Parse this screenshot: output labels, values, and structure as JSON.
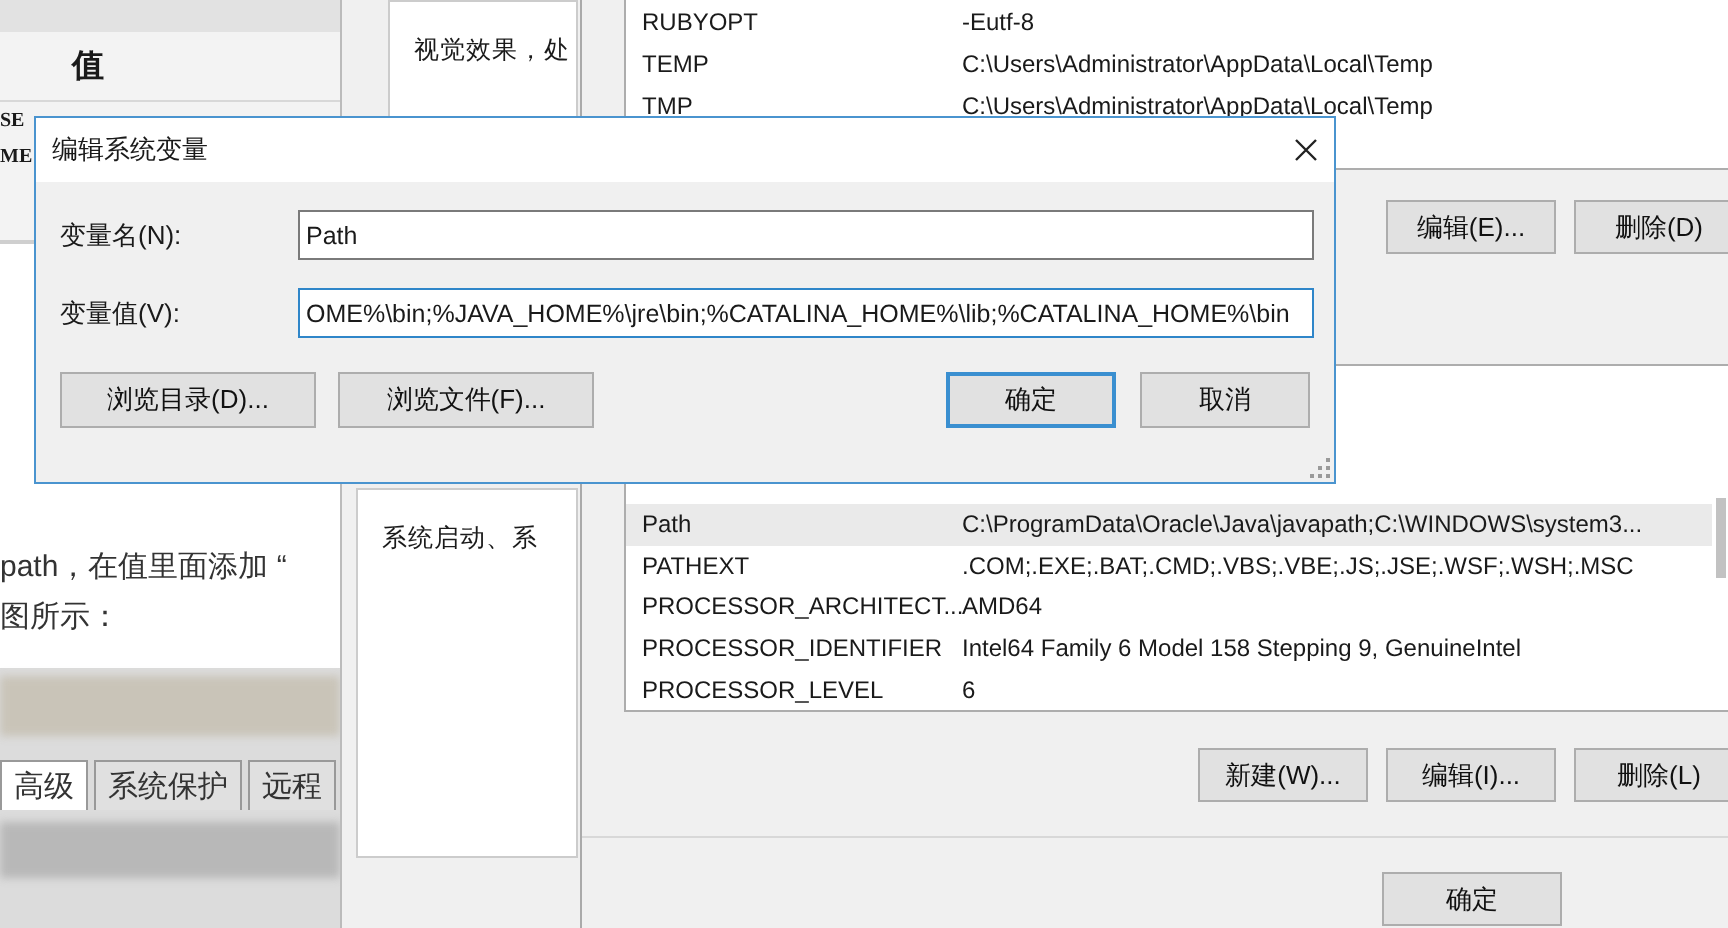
{
  "article": {
    "table_header": "值",
    "table_rows": [
      "SE",
      "ME"
    ],
    "text_lines": [
      "path，在值里面添加 “",
      "图所示："
    ],
    "tabs": [
      {
        "label": "高级",
        "selected": true
      },
      {
        "label": "系统保护",
        "selected": false
      },
      {
        "label": "远程",
        "selected": false
      }
    ]
  },
  "system_properties": {
    "panel_texts": [
      "视觉效果，处",
      "系统启动、系"
    ]
  },
  "environment_variables": {
    "user_variables": [
      {
        "name": "RUBYOPT",
        "value": "-Eutf-8"
      },
      {
        "name": "TEMP",
        "value": "C:\\Users\\Administrator\\AppData\\Local\\Temp"
      },
      {
        "name": "TMP",
        "value": "C:\\Users\\Administrator\\AppData\\Local\\Temp"
      }
    ],
    "user_buttons": [
      "编辑(E)...",
      "删除(D)"
    ],
    "system_variables": [
      {
        "name": "Path",
        "value": "C:\\ProgramData\\Oracle\\Java\\javapath;C:\\WINDOWS\\system3...",
        "selected": true
      },
      {
        "name": "PATHEXT",
        "value": ".COM;.EXE;.BAT;.CMD;.VBS;.VBE;.JS;.JSE;.WSF;.WSH;.MSC",
        "selected": false
      },
      {
        "name": "PROCESSOR_ARCHITECT...",
        "value": "AMD64",
        "selected": false
      },
      {
        "name": "PROCESSOR_IDENTIFIER",
        "value": "Intel64 Family 6 Model 158 Stepping 9, GenuineIntel",
        "selected": false
      },
      {
        "name": "PROCESSOR_LEVEL",
        "value": "6",
        "selected": false
      }
    ],
    "system_buttons": [
      "新建(W)...",
      "编辑(I)...",
      "删除(L)"
    ],
    "footer_buttons": [
      "确定"
    ]
  },
  "dialog": {
    "title": "编辑系统变量",
    "fields": [
      {
        "label": "变量名(N):",
        "value": "Path",
        "focused": false
      },
      {
        "label": "变量值(V):",
        "value": "OME%\\bin;%JAVA_HOME%\\jre\\bin;%CATALINA_HOME%\\lib;%CATALINA_HOME%\\bin",
        "focused": true
      }
    ],
    "buttons": [
      {
        "label": "浏览目录(D)...",
        "kind": "browse",
        "default": false
      },
      {
        "label": "浏览文件(F)...",
        "kind": "browse",
        "default": false
      },
      {
        "label": "确定",
        "kind": "action",
        "default": true
      },
      {
        "label": "取消",
        "kind": "action",
        "default": false
      }
    ]
  }
}
